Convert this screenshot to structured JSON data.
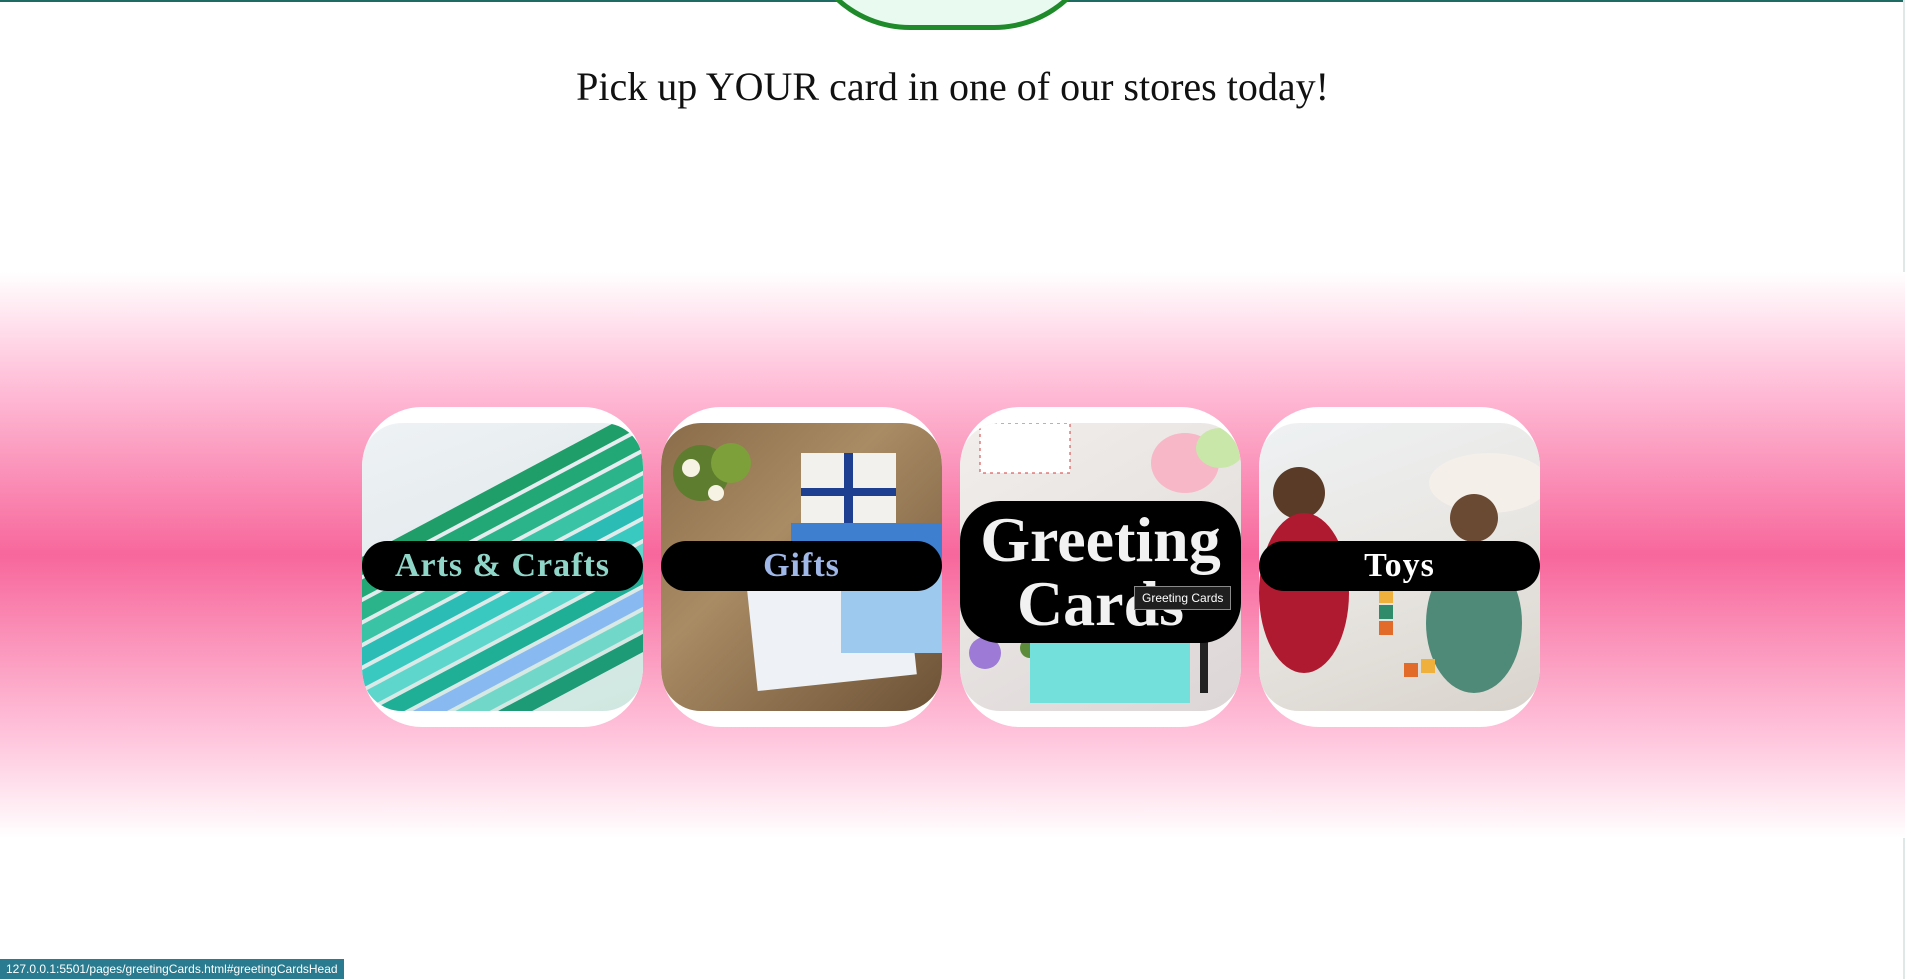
{
  "page": {
    "tagline": "Pick up YOUR card in one of our stores today!",
    "accent_color": "#1f8a2a",
    "band_color": "#f7679b"
  },
  "categories": [
    {
      "label": "Arts & Crafts",
      "image": "colored-pencils-photo"
    },
    {
      "label": "Gifts",
      "image": "wrapped-gift-boxes-photo"
    },
    {
      "label": "Greeting Cards",
      "image": "greeting-cards-flatlay-photo"
    },
    {
      "label": "Toys",
      "image": "children-playing-blocks-photo"
    }
  ],
  "tooltip": {
    "text": "Greeting Cards"
  },
  "status_bar": {
    "url": "127.0.0.1:5501/pages/greetingCards.html#greetingCardsHead"
  }
}
